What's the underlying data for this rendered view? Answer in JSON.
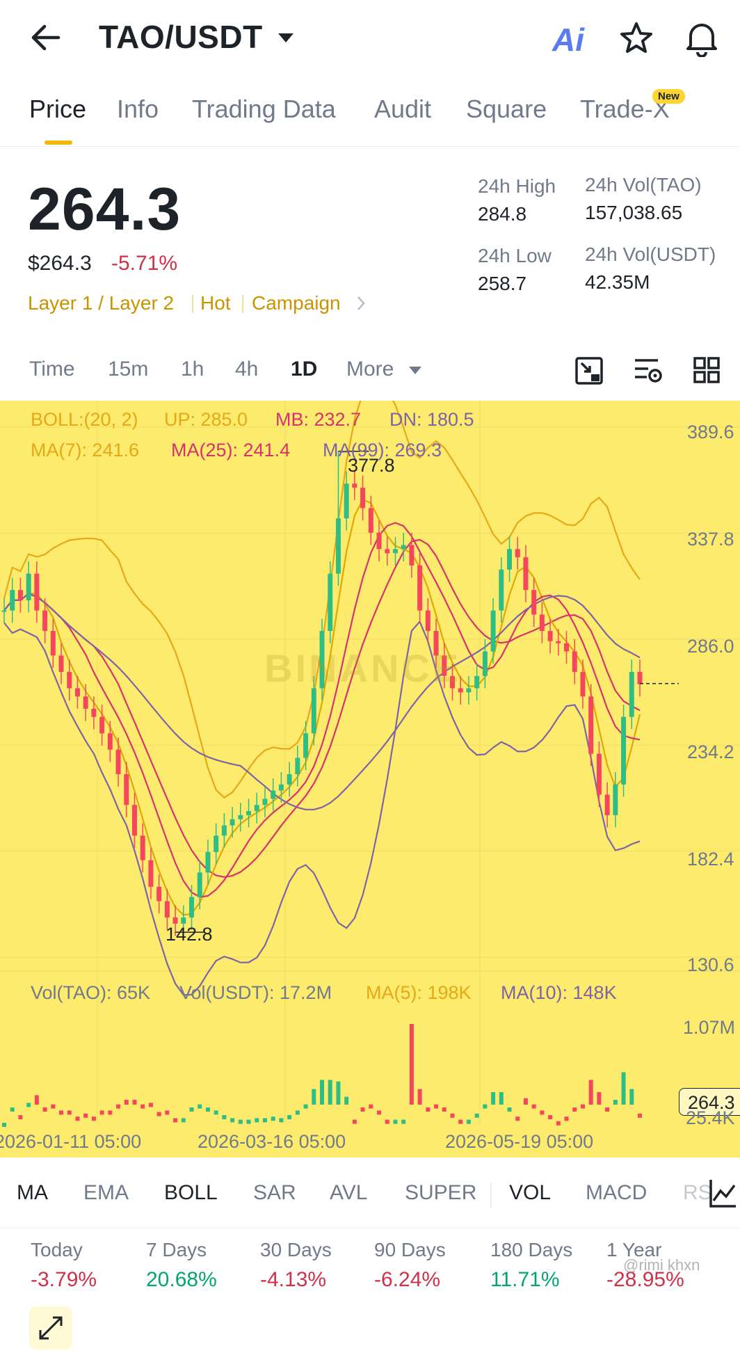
{
  "header": {
    "pair": "TAO/USDT",
    "ai_label": "Ai"
  },
  "tabs": [
    "Price",
    "Info",
    "Trading Data",
    "Audit",
    "Square",
    "Trade-X"
  ],
  "tabs_new_badge": "New",
  "price": {
    "last": "264.3",
    "usd": "$264.3",
    "change": "-5.71%",
    "categories": [
      "Layer 1 / Layer 2",
      "Hot",
      "Campaign"
    ]
  },
  "stats": {
    "high_label": "24h High",
    "high": "284.8",
    "low_label": "24h Low",
    "low": "258.7",
    "vol_tao_label": "24h Vol(TAO)",
    "vol_tao": "157,038.65",
    "vol_usdt_label": "24h Vol(USDT)",
    "vol_usdt": "42.35M"
  },
  "timeframes": [
    "Time",
    "15m",
    "1h",
    "4h",
    "1D",
    "More"
  ],
  "timeframe_selected": "1D",
  "chart_legend": {
    "boll": "BOLL:(20, 2)",
    "up": "UP: 285.0",
    "mb": "MB: 232.7",
    "dn": "DN: 180.5",
    "ma7": "MA(7): 241.6",
    "ma25": "MA(25): 241.4",
    "ma99": "MA(99): 269.3",
    "vol_tao": "Vol(TAO): 65K",
    "vol_usdt": "Vol(USDT): 17.2M",
    "vol_ma5": "MA(5): 198K",
    "vol_ma10": "MA(10): 148K"
  },
  "chart_labels": {
    "high_marker": "377.8",
    "low_marker": "142.8",
    "current": "264.3",
    "watermark": "BINANCE"
  },
  "chart_data": {
    "type": "line",
    "y_ticks": [
      "389.6",
      "337.8",
      "286.0",
      "234.2",
      "182.4",
      "130.6"
    ],
    "vol_ticks": [
      "1.07M",
      "25.4K"
    ],
    "x_ticks": [
      "2026-01-11 05:00",
      "2026-03-16 05:00",
      "2026-05-19 05:00"
    ],
    "ylim": [
      130.6,
      389.6
    ],
    "series": [
      {
        "name": "Close",
        "values": [
          300,
          310,
          305,
          318,
          300,
          290,
          278,
          270,
          262,
          258,
          252,
          248,
          240,
          232,
          220,
          205,
          190,
          178,
          165,
          158,
          150,
          147,
          150,
          160,
          172,
          182,
          190,
          195,
          198,
          200,
          202,
          205,
          208,
          212,
          215,
          220,
          228,
          240,
          262,
          290,
          318,
          345,
          362,
          360,
          350,
          338,
          330,
          328,
          330,
          332,
          322,
          300,
          290,
          278,
          268,
          262,
          260,
          262,
          268,
          280,
          300,
          320,
          330,
          326,
          310,
          298,
          290,
          285,
          284,
          280,
          270,
          258,
          230,
          210,
          200,
          215,
          248,
          270,
          264
        ]
      }
    ],
    "colors": {
      "up": "#2ebd85",
      "down": "#f6465d",
      "boll": "#e6a817",
      "ma7": "#e0a800",
      "ma25": "#d6336c",
      "ma99": "#7d64a6",
      "background": "#fdeb6e"
    }
  },
  "indicators": [
    "MA",
    "EMA",
    "BOLL",
    "SAR",
    "AVL",
    "SUPER",
    "VOL",
    "MACD",
    "RSI"
  ],
  "indicators_active": [
    "MA",
    "BOLL",
    "VOL"
  ],
  "performance": [
    {
      "label": "Today",
      "value": "-3.79%",
      "dir": "down"
    },
    {
      "label": "7 Days",
      "value": "20.68%",
      "dir": "up"
    },
    {
      "label": "30 Days",
      "value": "-4.13%",
      "dir": "down"
    },
    {
      "label": "90 Days",
      "value": "-6.24%",
      "dir": "down"
    },
    {
      "label": "180 Days",
      "value": "11.71%",
      "dir": "up"
    },
    {
      "label": "1 Year",
      "value": "-28.95%",
      "dir": "down"
    }
  ],
  "watermark_user": "@rimi khxn"
}
